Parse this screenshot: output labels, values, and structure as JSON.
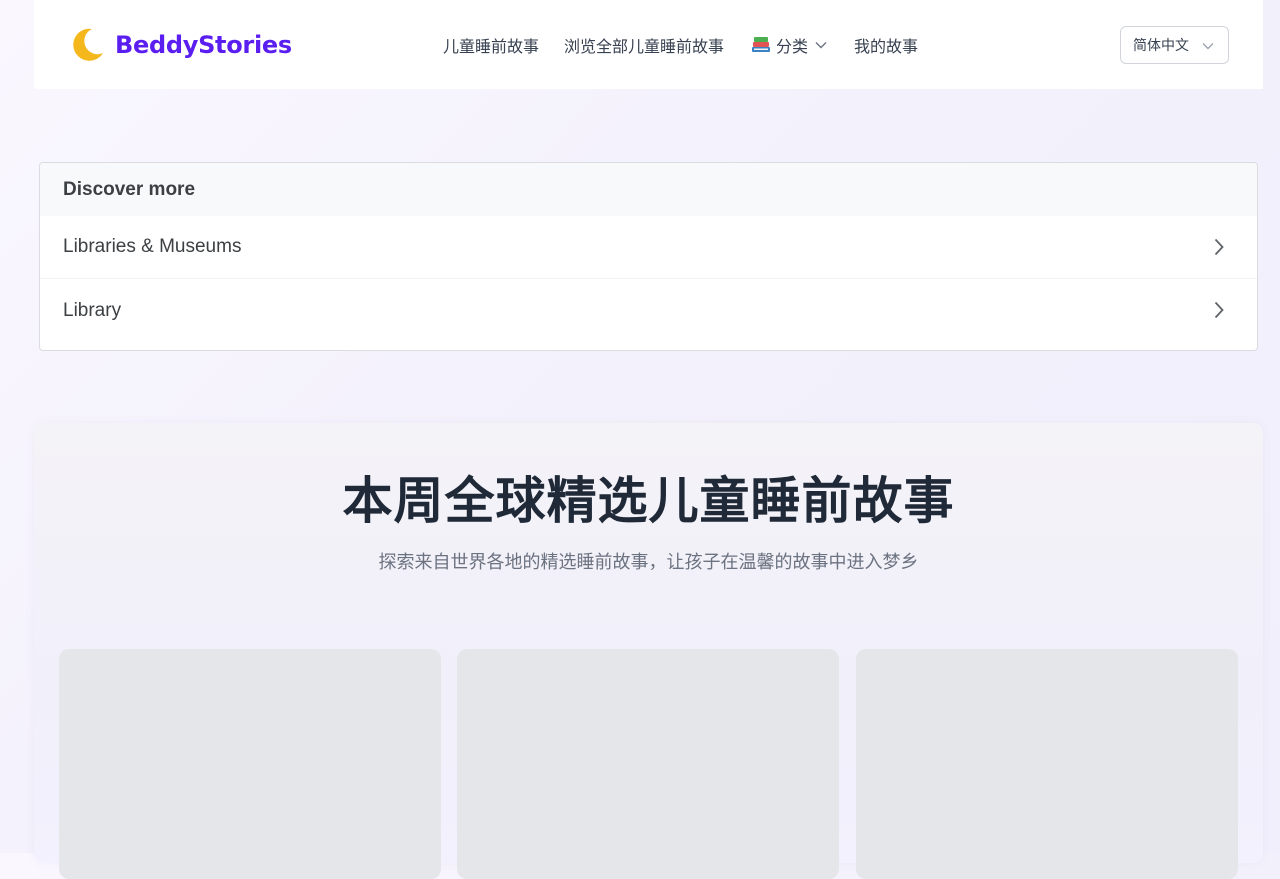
{
  "header": {
    "logo_text": "BeddyStories",
    "nav": [
      {
        "label": "儿童睡前故事"
      },
      {
        "label": "浏览全部儿童睡前故事"
      },
      {
        "label": "分类",
        "icon": "books-icon"
      },
      {
        "label": "我的故事"
      }
    ],
    "language": "简体中文"
  },
  "discover": {
    "title": "Discover more",
    "items": [
      {
        "label": "Libraries & Museums"
      },
      {
        "label": "Library"
      }
    ]
  },
  "featured": {
    "title": "本周全球精选儿童睡前故事",
    "subtitle": "探索来自世界各地的精选睡前故事，让孩子在温馨的故事中进入梦乡",
    "cards": [
      {},
      {},
      {}
    ]
  },
  "colors": {
    "brand": "#5b1ef0",
    "moon": "#f5b81c",
    "page_bg": "#f3f1fb",
    "card_placeholder": "#e5e6ea"
  }
}
